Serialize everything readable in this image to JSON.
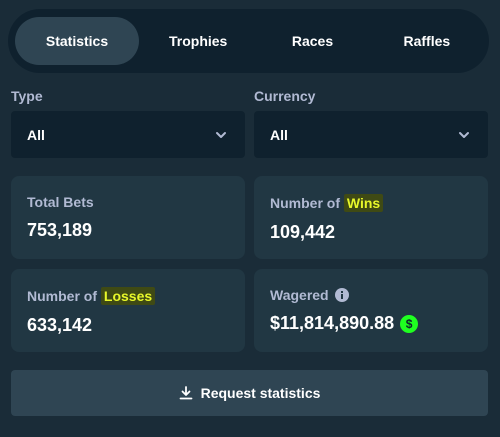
{
  "tabs": [
    {
      "label": "Statistics",
      "active": true
    },
    {
      "label": "Trophies"
    },
    {
      "label": "Races"
    },
    {
      "label": "Raffles"
    }
  ],
  "filters": {
    "type": {
      "label": "Type",
      "value": "All"
    },
    "currency": {
      "label": "Currency",
      "value": "All"
    }
  },
  "stats": {
    "total_bets": {
      "label": "Total Bets",
      "value": "753,189"
    },
    "wins": {
      "label_prefix": "Number of ",
      "label_highlight": "Wins",
      "value": "109,442"
    },
    "losses": {
      "label_prefix": "Number of ",
      "label_highlight": "Losses",
      "value": "633,142"
    },
    "wagered": {
      "label": "Wagered",
      "value": "$11,814,890.88",
      "currency_icon": "dollar-coin-icon",
      "currency_symbol": "$"
    }
  },
  "request_button": {
    "label": "Request statistics",
    "icon": "download-icon"
  },
  "colors": {
    "background": "#1a2c38",
    "card": "#213743",
    "input": "#0f212e",
    "highlight_text": "#e7f72a",
    "coin": "#1fff20"
  }
}
